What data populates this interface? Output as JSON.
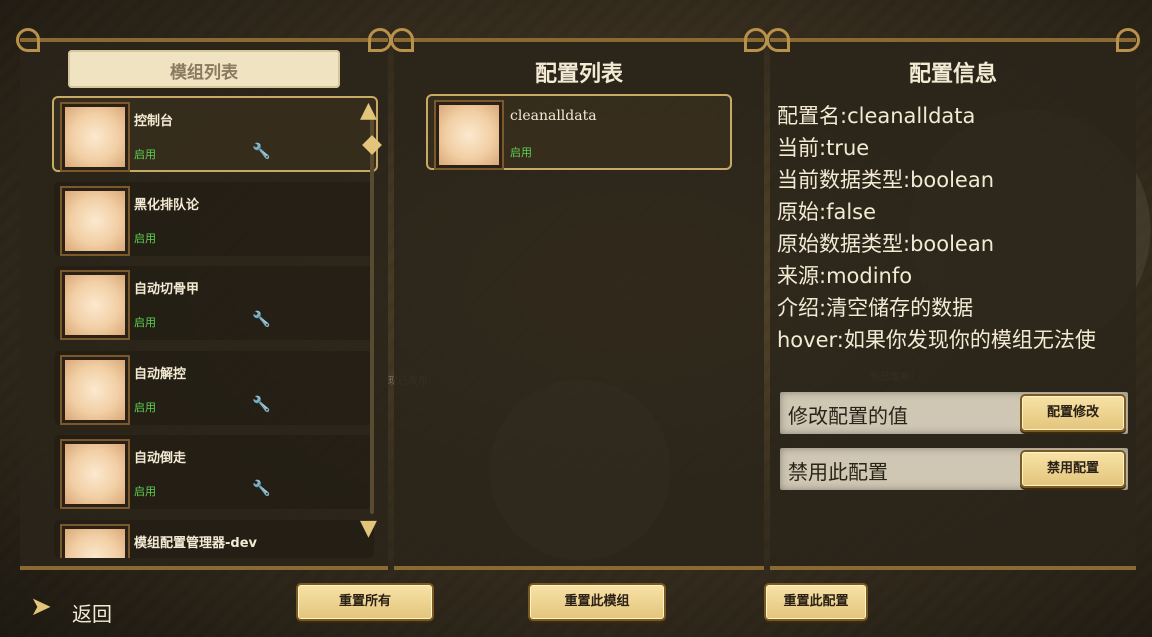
{
  "mod_panel": {
    "title": "模组列表",
    "items": [
      {
        "name": "控制台",
        "status": "启用",
        "has_config": true,
        "selected": true
      },
      {
        "name": "黑化排队论",
        "status": "启用",
        "has_config": false
      },
      {
        "name": "自动切骨甲",
        "status": "启用",
        "has_config": true
      },
      {
        "name": "自动解控",
        "status": "启用",
        "has_config": true
      },
      {
        "name": "自动倒走",
        "status": "启用",
        "has_config": true
      },
      {
        "name": "模组配置管理器-dev",
        "status": "",
        "has_config": false
      }
    ]
  },
  "config_panel": {
    "title": "配置列表",
    "items": [
      {
        "name": "cleanalldata",
        "status": "启用"
      }
    ]
  },
  "info_panel": {
    "title": "配置信息",
    "lines": [
      "配置名:cleanalldata",
      "当前:true",
      "当前数据类型:boolean",
      "原始:false",
      "原始数据类型:boolean",
      "来源:modinfo",
      "介绍:清空储存的数据",
      "hover:如果你发现你的模组无法使"
    ],
    "modify_label": "修改配置的值",
    "modify_button": "配置修改",
    "disable_label": "禁用此配置",
    "disable_button": "禁用配置"
  },
  "bottom": {
    "back": "返回",
    "reset_all": "重置所有",
    "reset_mod": "重置此模组",
    "reset_config": "重置此配置"
  },
  "colors": {
    "accent_gold": "#e3c57c",
    "enabled_green": "#5fd04f",
    "parchment": "#efe3c2"
  }
}
